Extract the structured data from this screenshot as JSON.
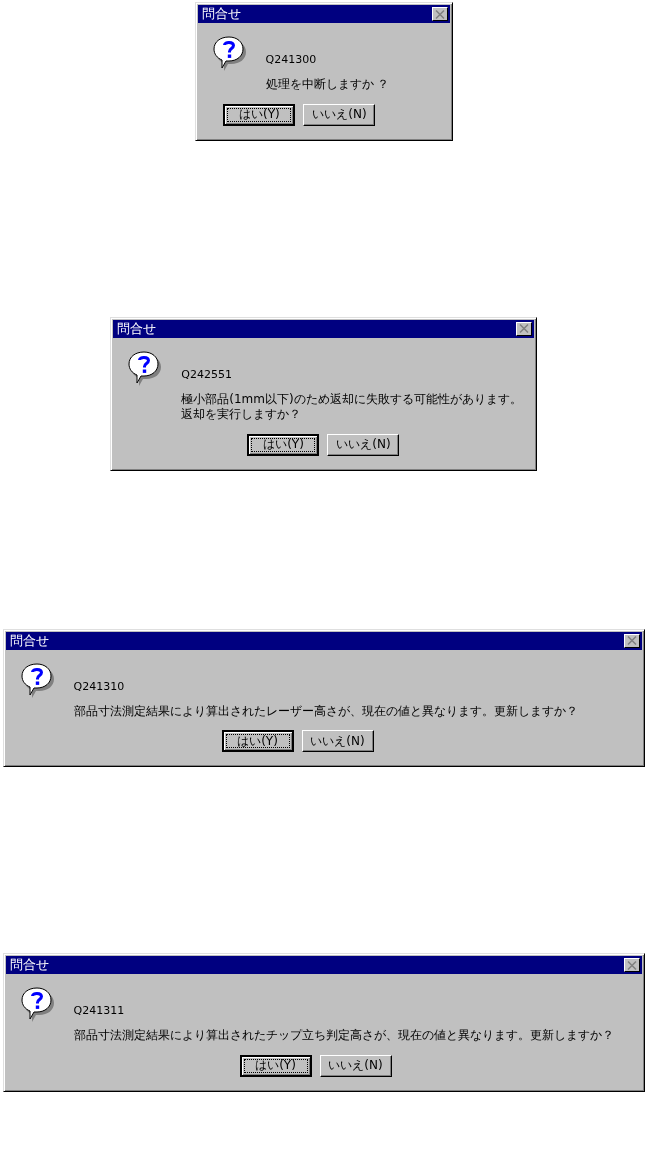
{
  "dialogs": [
    {
      "title": "問合せ",
      "code": "Q241300",
      "message": [
        "処理を中断しますか ？"
      ],
      "buttons": [
        {
          "label": "はい(Y)",
          "default": true
        },
        {
          "label": "いいえ(N)",
          "default": false
        }
      ]
    },
    {
      "title": "問合せ",
      "code": "Q242551",
      "message": [
        "極小部品(1mm以下)のため返却に失敗する可能性があります。",
        "返却を実行しますか？"
      ],
      "buttons": [
        {
          "label": "はい(Y)",
          "default": true
        },
        {
          "label": "いいえ(N)",
          "default": false
        }
      ]
    },
    {
      "title": "問合せ",
      "code": "Q241310",
      "message": [
        "部品寸法測定結果により算出されたレーザー高さが、現在の値と異なります。更新しますか？"
      ],
      "buttons": [
        {
          "label": "はい(Y)",
          "default": true
        },
        {
          "label": "いいえ(N)",
          "default": false
        }
      ]
    },
    {
      "title": "問合せ",
      "code": "Q241311",
      "message": [
        "部品寸法測定結果により算出されたチップ立ち判定高さが、現在の値と異なります。更新しますか？"
      ],
      "buttons": [
        {
          "label": "はい(Y)",
          "default": true
        },
        {
          "label": "いいえ(N)",
          "default": false
        }
      ]
    }
  ]
}
